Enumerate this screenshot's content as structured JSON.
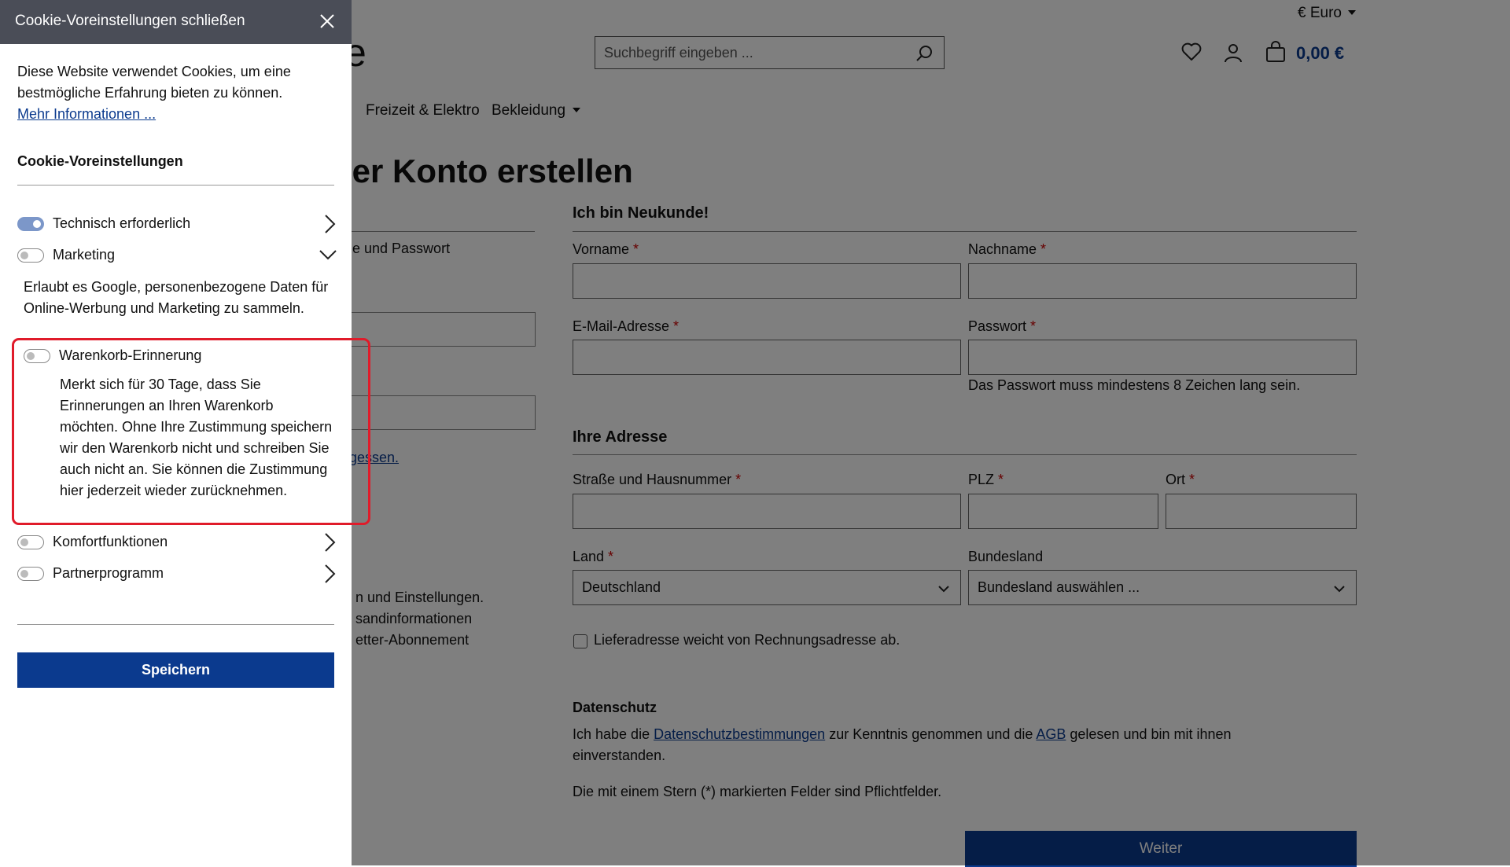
{
  "header": {
    "currency": "€ Euro",
    "logo_fragment": "e",
    "search_placeholder": "Suchbegriff eingeben ...",
    "cart_total": "0,00 €"
  },
  "nav": {
    "items": [
      {
        "label": "Freizeit & Elektro"
      },
      {
        "label": "Bekleidung"
      }
    ],
    "leading_fragment": ":"
  },
  "main": {
    "title": "der Konto erstellen",
    "login": {
      "fragment": "e und Passwort",
      "link_fragment": "gessen.",
      "colon_fragment": ":",
      "benefits": [
        "n und Einstellungen.",
        "sandinformationen",
        "etter-Abonnement"
      ]
    },
    "register": {
      "heading": "Ich bin Neukunde!",
      "vorname_label": "Vorname",
      "nachname_label": "Nachname",
      "email_label": "E-Mail-Adresse",
      "passwort_label": "Passwort",
      "password_hint": "Das Passwort muss mindestens 8 Zeichen lang sein.",
      "required_mark": "*"
    },
    "address": {
      "heading": "Ihre Adresse",
      "strasse_label": "Straße und Hausnummer",
      "plz_label": "PLZ",
      "ort_label": "Ort",
      "land_label": "Land",
      "land_value": "Deutschland",
      "bundesland_label": "Bundesland",
      "bundesland_value": "Bundesland auswählen ...",
      "delivery_checkbox_label": "Lieferadresse weicht von Rechnungsadresse ab."
    },
    "privacy": {
      "heading": "Datenschutz",
      "text_before": "Ich habe die ",
      "privacy_link": "Datenschutzbestimmungen",
      "text_middle": " zur Kenntnis genommen und die ",
      "agb_link": "AGB",
      "text_after": " gelesen und bin mit ihnen einverstanden.",
      "required_note": "Die mit einem Stern (*) markierten Felder sind Pflichtfelder."
    },
    "submit_label": "Weiter"
  },
  "cookie": {
    "close_title": "Cookie-Voreinstellungen schließen",
    "intro": "Diese Website verwendet Cookies, um eine bestmögliche Erfahrung bieten zu können.",
    "more_info_link": "Mehr Informationen ...",
    "heading": "Cookie-Voreinstellungen",
    "categories": [
      {
        "label": "Technisch erforderlich",
        "enabled": true
      },
      {
        "label": "Marketing",
        "enabled": false
      },
      {
        "label": "Komfortfunktionen",
        "enabled": false
      },
      {
        "label": "Partnerprogramm",
        "enabled": false
      }
    ],
    "marketing_desc": "Erlaubt es Google, personenbezogene Daten für Online-Werbung und Marketing zu sammeln.",
    "cart_reminder": {
      "label": "Warenkorb-Erinnerung",
      "enabled": false,
      "desc": "Merkt sich für 30 Tage, dass Sie Erinnerungen an Ihren Warenkorb möchten. Ohne Ihre Zustimmung speichern wir den Warenkorb nicht und schreiben Sie auch nicht an. Sie können die Zustimmung hier jederzeit wieder zurücknehmen."
    },
    "save_label": "Speichern"
  },
  "colors": {
    "primary": "#0b3a8e",
    "toggle_on": "#7c97c9",
    "highlight": "#e01b2a",
    "required": "#cc0000",
    "header_bg": "#4a4d57"
  }
}
